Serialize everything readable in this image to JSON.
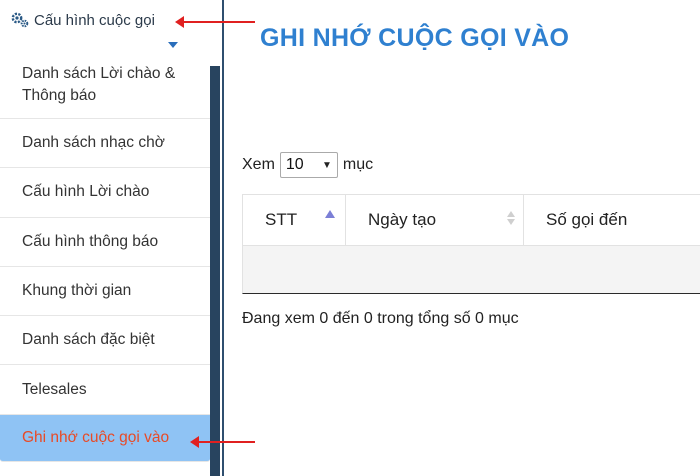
{
  "sidebar": {
    "header_label": "Cấu hình cuộc gọi",
    "items": [
      {
        "label": "Danh sách Lời chào & Thông báo"
      },
      {
        "label": "Danh sách nhạc chờ"
      },
      {
        "label": "Cấu hình Lời chào"
      },
      {
        "label": "Cấu hình thông báo"
      },
      {
        "label": "Khung thời gian"
      },
      {
        "label": "Danh sách đặc biệt"
      },
      {
        "label": "Telesales"
      },
      {
        "label": "Ghi nhớ cuộc gọi vào"
      }
    ]
  },
  "main": {
    "title": "GHI NHỚ CUỘC GỌI VÀO",
    "length": {
      "prefix": "Xem",
      "value": "10",
      "suffix": "mục"
    },
    "table": {
      "columns": [
        "STT",
        "Ngày tạo",
        "Số gọi đến"
      ]
    },
    "info": "Đang xem 0 đến 0 trong tổng số 0 mục"
  },
  "icons": {
    "header_icon": "gear-icon",
    "expand_icon": "chevron-down-icon"
  },
  "colors": {
    "title": "#2f80d0",
    "active_bg": "#8fc3f4",
    "active_text": "#e84a26",
    "annotation_arrow": "#e02020",
    "sidebar_scrollbar": "#28445f"
  }
}
